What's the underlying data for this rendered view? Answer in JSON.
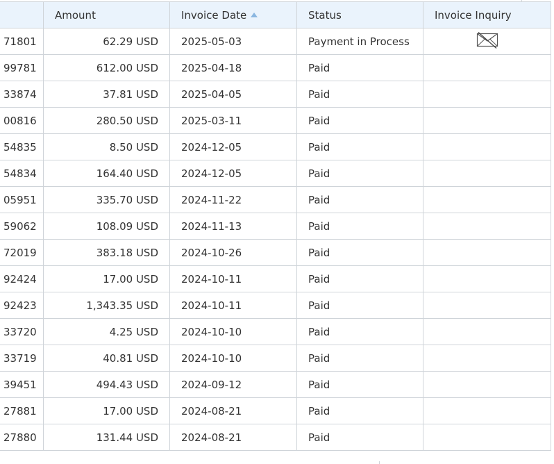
{
  "columns": {
    "number": "",
    "amount": "Amount",
    "invoice_date": "Invoice Date",
    "status": "Status",
    "inquiry": "Invoice Inquiry"
  },
  "sort": {
    "column": "invoice_date",
    "direction": "ascending-indicator",
    "icon": "sort-arrow-up-icon",
    "color": "#8ab6e0"
  },
  "colors": {
    "header_bg": "#eaf3fc",
    "border": "#cfd4d9",
    "text": "#333333"
  },
  "rows": [
    {
      "number": "71801",
      "amount": "62.29 USD",
      "date": "2025-05-03",
      "status": "Payment in Process",
      "inquiry_icon": "envelope-crossed-icon"
    },
    {
      "number": "99781",
      "amount": "612.00 USD",
      "date": "2025-04-18",
      "status": "Paid"
    },
    {
      "number": "33874",
      "amount": "37.81 USD",
      "date": "2025-04-05",
      "status": "Paid"
    },
    {
      "number": "00816",
      "amount": "280.50 USD",
      "date": "2025-03-11",
      "status": "Paid"
    },
    {
      "number": "54835",
      "amount": "8.50 USD",
      "date": "2024-12-05",
      "status": "Paid"
    },
    {
      "number": "54834",
      "amount": "164.40 USD",
      "date": "2024-12-05",
      "status": "Paid"
    },
    {
      "number": "05951",
      "amount": "335.70 USD",
      "date": "2024-11-22",
      "status": "Paid"
    },
    {
      "number": "59062",
      "amount": "108.09 USD",
      "date": "2024-11-13",
      "status": "Paid"
    },
    {
      "number": "72019",
      "amount": "383.18 USD",
      "date": "2024-10-26",
      "status": "Paid"
    },
    {
      "number": "92424",
      "amount": "17.00 USD",
      "date": "2024-10-11",
      "status": "Paid"
    },
    {
      "number": "92423",
      "amount": "1,343.35 USD",
      "date": "2024-10-11",
      "status": "Paid"
    },
    {
      "number": "33720",
      "amount": "4.25 USD",
      "date": "2024-10-10",
      "status": "Paid"
    },
    {
      "number": "33719",
      "amount": "40.81 USD",
      "date": "2024-10-10",
      "status": "Paid"
    },
    {
      "number": "39451",
      "amount": "494.43 USD",
      "date": "2024-09-12",
      "status": "Paid"
    },
    {
      "number": "27881",
      "amount": "17.00 USD",
      "date": "2024-08-21",
      "status": "Paid"
    },
    {
      "number": "27880",
      "amount": "131.44 USD",
      "date": "2024-08-21",
      "status": "Paid"
    }
  ]
}
